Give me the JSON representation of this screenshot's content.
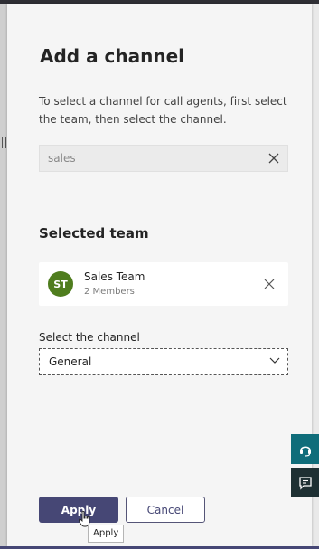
{
  "dialog": {
    "title": "Add a channel",
    "description": "To select a channel for call agents, first select the team, then select the channel."
  },
  "search": {
    "value": "sales",
    "placeholder": ""
  },
  "selected_team": {
    "heading": "Selected team",
    "avatar_initials": "ST",
    "avatar_color": "#4f7d1e",
    "name": "Sales Team",
    "members": "2 Members"
  },
  "channel": {
    "label": "Select the channel",
    "selected": "General"
  },
  "buttons": {
    "apply": "Apply",
    "cancel": "Cancel",
    "apply_tooltip": "Apply"
  },
  "side_widgets": {
    "top_icon": "headset-icon",
    "bottom_icon": "chat-feedback-icon"
  },
  "colors": {
    "accent": "#464775",
    "panel_bg": "#f5f5f5"
  }
}
